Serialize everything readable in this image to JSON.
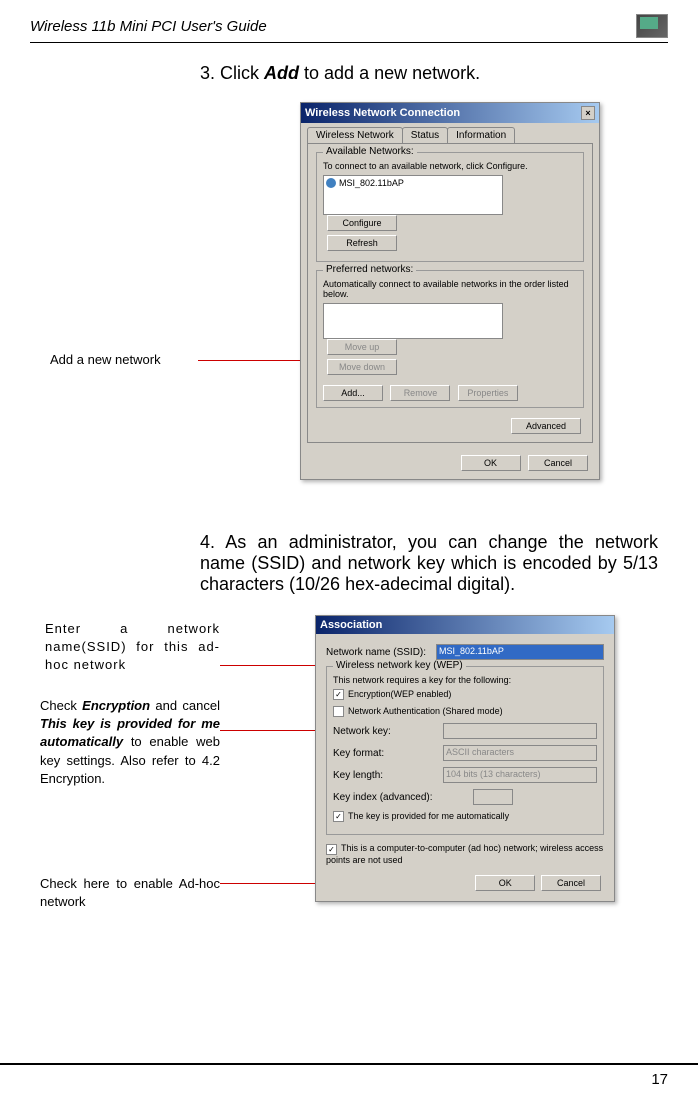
{
  "header": {
    "title": "Wireless 11b Mini PCI  User's Guide"
  },
  "step3": {
    "prefix": "3. Click ",
    "bold": "Add",
    "suffix": " to add a new network."
  },
  "dialog1": {
    "title": "Wireless Network Connection",
    "tabs": {
      "t1": "Wireless Network",
      "t2": "Status",
      "t3": "Information"
    },
    "available": {
      "legend": "Available Networks:",
      "help": "To connect to an available network, click Configure.",
      "item": "MSI_802.11bAP",
      "configure": "Configure",
      "refresh": "Refresh"
    },
    "preferred": {
      "legend": "Preferred networks:",
      "help": "Automatically connect to available networks in the order listed below.",
      "moveup": "Move up",
      "movedown": "Move down",
      "add": "Add...",
      "remove": "Remove",
      "properties": "Properties"
    },
    "advanced": "Advanced",
    "ok": "OK",
    "cancel": "Cancel"
  },
  "callouts": {
    "addNetwork": "Add a new network"
  },
  "step4": {
    "text": "4. As an administrator, you can change the network name (SSID) and network key which is encoded by 5/13 characters (10/26 hex-adecimal digital)."
  },
  "dialog2": {
    "title": "Association",
    "ssidLabel": "Network name (SSID):",
    "ssidValue": "MSI_802.11bAP",
    "wepLegend": "Wireless network key (WEP)",
    "wepHelp": "This network requires a key for the following:",
    "encryption": "Encryption(WEP enabled)",
    "netauth": "Network Authentication (Shared mode)",
    "netkey": "Network key:",
    "keyformat": "Key format:",
    "keyformatVal": "ASCII characters",
    "keylength": "Key length:",
    "keylengthVal": "104 bits (13 characters)",
    "keyindex": "Key index (advanced):",
    "autoKey": "The key is provided for me automatically",
    "adhoc": "This is a computer-to-computer (ad hoc) network; wireless access points are not used",
    "ok": "OK",
    "cancel": "Cancel"
  },
  "callouts2": {
    "ssid": "Enter a network name(SSID) for this ad-hoc network",
    "encryption_pre": "Check ",
    "encryption_b1": "Encryption",
    "encryption_mid": " and cancel ",
    "encryption_b2": "This key is provided for me automatically",
    "encryption_post": " to enable web key settings. Also refer to 4.2 Encryption.",
    "adhoc": "Check here to enable Ad-hoc network"
  },
  "pageNum": "17"
}
